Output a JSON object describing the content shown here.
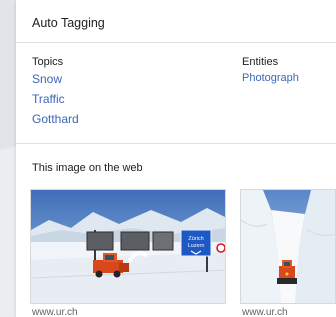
{
  "panel": {
    "title": "Auto Tagging",
    "topics_heading": "Topics",
    "topics": [
      "Snow",
      "Traffic",
      "Gotthard"
    ],
    "entities_heading": "Entities",
    "entities": [
      "Photograph"
    ]
  },
  "web": {
    "heading": "This image on the web",
    "results": [
      {
        "source": "www.ur.ch",
        "sign_line1": "Zürich",
        "sign_line2": "Luzern"
      },
      {
        "source": "www.ur.ch"
      }
    ]
  },
  "colors": {
    "link": "#3b67b8",
    "text": "#202124",
    "divider": "#dfe1e5",
    "page_bg": "#ecedf1"
  }
}
